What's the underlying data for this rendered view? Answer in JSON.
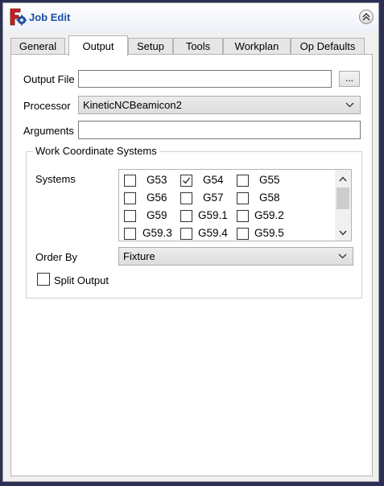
{
  "header": {
    "title": "Job Edit"
  },
  "tabs": [
    {
      "label": "General"
    },
    {
      "label": "Output"
    },
    {
      "label": "Setup"
    },
    {
      "label": "Tools"
    },
    {
      "label": "Workplan"
    },
    {
      "label": "Op Defaults"
    }
  ],
  "active_tab": "Output",
  "output_file": {
    "label": "Output File",
    "value": "",
    "browse_label": "..."
  },
  "processor": {
    "label": "Processor",
    "value": "KineticNCBeamicon2"
  },
  "arguments": {
    "label": "Arguments",
    "value": ""
  },
  "wcs": {
    "title": "Work Coordinate Systems",
    "systems_label": "Systems",
    "items": [
      {
        "label": "G53",
        "checked": false
      },
      {
        "label": "G54",
        "checked": true
      },
      {
        "label": "G55",
        "checked": false
      },
      {
        "label": "G56",
        "checked": false
      },
      {
        "label": "G57",
        "checked": false
      },
      {
        "label": "G58",
        "checked": false
      },
      {
        "label": "G59",
        "checked": false
      },
      {
        "label": "G59.1",
        "checked": false
      },
      {
        "label": "G59.2",
        "checked": false
      },
      {
        "label": "G59.3",
        "checked": false
      },
      {
        "label": "G59.4",
        "checked": false
      },
      {
        "label": "G59.5",
        "checked": false
      }
    ],
    "order_by_label": "Order By",
    "order_by_value": "Fixture",
    "split_output_label": "Split Output",
    "split_output_checked": false
  },
  "colors": {
    "title_blue": "#1a4fa6",
    "accent_red": "#cc1f1f",
    "background": "#2c2f55"
  }
}
